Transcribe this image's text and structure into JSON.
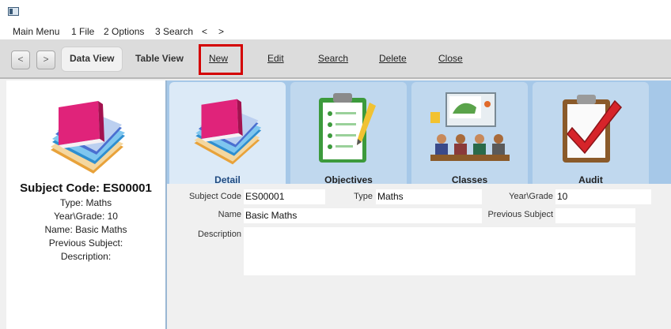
{
  "menubar": {
    "items": [
      "Main Menu",
      "1 File",
      "2 Options",
      "3 Search",
      "<",
      ">"
    ]
  },
  "toolbar": {
    "back": "<",
    "forward": ">",
    "data_view": "Data View",
    "table_view": "Table View",
    "new": "New",
    "edit": "Edit",
    "search": "Search",
    "delete": "Delete",
    "close": "Close"
  },
  "summary": {
    "title": "Subject Code: ES00001",
    "type": "Type: Maths",
    "year_grade": "Year\\Grade: 10",
    "name": "Name: Basic Maths",
    "previous_subject": "Previous Subject:",
    "description": "Description:"
  },
  "tabs": [
    {
      "label": "Detail",
      "icon": "books-icon",
      "active": true
    },
    {
      "label": "Objectives",
      "icon": "clipboard-checklist-icon",
      "active": false
    },
    {
      "label": "Classes",
      "icon": "classroom-icon",
      "active": false
    },
    {
      "label": "Audit",
      "icon": "audit-checkmark-icon",
      "active": false
    }
  ],
  "form": {
    "subject_code_label": "Subject Code",
    "subject_code_value": "ES00001",
    "type_label": "Type",
    "type_value": "Maths",
    "year_grade_label": "Year\\Grade",
    "year_grade_value": "10",
    "name_label": "Name",
    "name_value": "Basic Maths",
    "previous_subject_label": "Previous Subject",
    "previous_subject_value": "",
    "description_label": "Description",
    "description_value": ""
  },
  "colors": {
    "highlight": "#d40000",
    "tab_strip": "#a6c8e8",
    "tab_active": "#dceaf7"
  }
}
